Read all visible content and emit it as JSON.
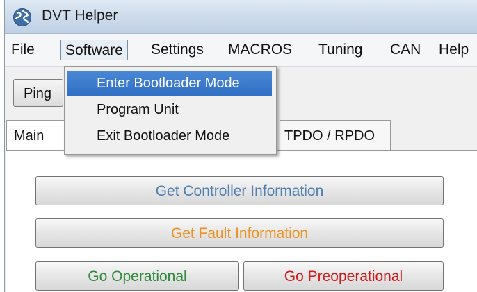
{
  "window": {
    "title": "DVT Helper",
    "icon": "globe-icon"
  },
  "menubar": {
    "items": [
      "File",
      "Software",
      "Settings",
      "MACROS",
      "Tuning",
      "CAN",
      "Help"
    ],
    "active": "Software"
  },
  "toolbar": {
    "ping_label": "Ping"
  },
  "tabs": {
    "main_label": "Main",
    "pdo_label": "TPDO / RPDO"
  },
  "dropdown": {
    "items": [
      "Enter Bootloader Mode",
      "Program Unit",
      "Exit Bootloader Mode"
    ],
    "highlighted": "Enter Bootloader Mode"
  },
  "buttons": {
    "controller_info": "Get Controller Information",
    "fault_info": "Get Fault Information",
    "go_operational": "Go Operational",
    "go_preoperational": "Go Preoperational"
  },
  "colors": {
    "controller_info": "#4f7fb0",
    "fault_info": "#f0901e",
    "go_operational": "#2f8a3a",
    "go_preoperational": "#d21919",
    "highlight": "#3a7bd0"
  }
}
